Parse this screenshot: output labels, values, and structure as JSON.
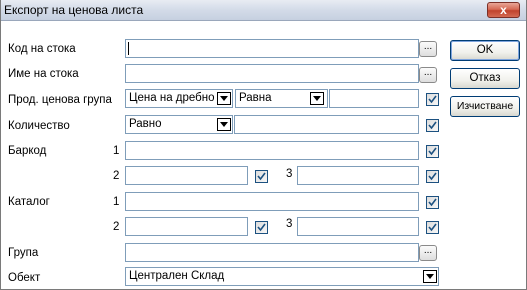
{
  "window": {
    "title": "Експорт на ценова листа",
    "close_glyph": "x"
  },
  "form": {
    "code_label": "Код на стока",
    "name_label": "Име на стока",
    "price_group_label": "Прод. ценова група",
    "price_group_value": "Цена на дребно",
    "price_group_operator": "Равна",
    "quantity_label": "Количество",
    "quantity_operator": "Равно",
    "barcode_label": "Баркод",
    "catalog_label": "Каталог",
    "group_label": "Група",
    "object_label": "Обект",
    "object_value": "Централен Склад",
    "index_1": "1",
    "index_2": "2",
    "index_3": "3",
    "ellipsis": "..."
  },
  "buttons": {
    "ok": "OK",
    "cancel": "Отказ",
    "clear": "Изчистване"
  },
  "colors": {
    "field_border": "#7f9db9",
    "titlebar": "#d3dbe8",
    "close_button": "#c0432c",
    "checkmark": "#1c5180"
  }
}
